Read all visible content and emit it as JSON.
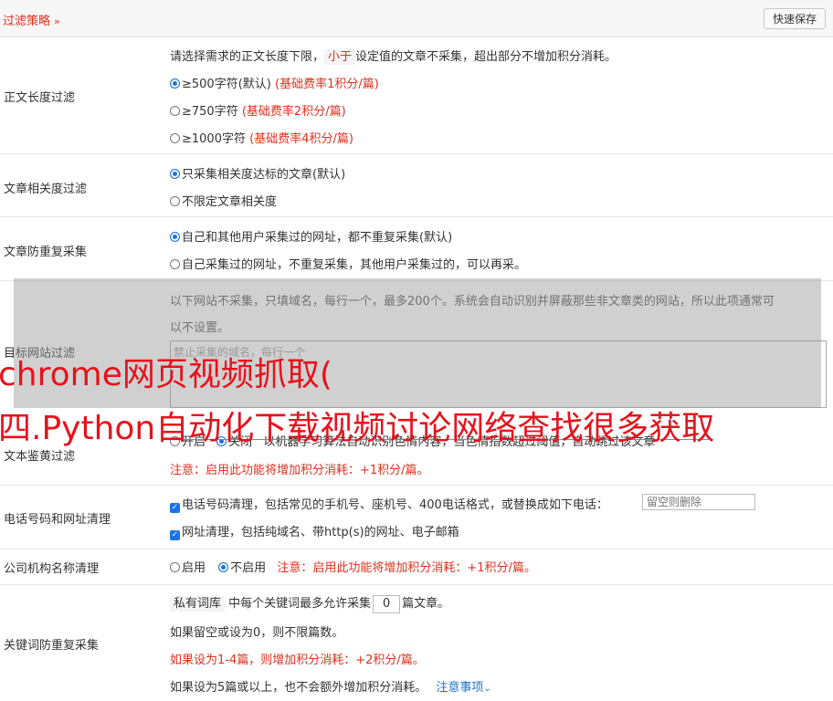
{
  "header": {
    "title": "过滤策略",
    "chevron": "»",
    "save_label": "快速保存"
  },
  "length_filter": {
    "label": "正文长度过滤",
    "desc_pre": "请选择需求的正文长度下限，",
    "desc_tag": "小于",
    "desc_post": "设定值的文章不采集，超出部分不增加积分消耗。",
    "options": [
      {
        "text": "≥500字符(默认)",
        "note": "(基础费率1积分/篇)",
        "checked": true
      },
      {
        "text": "≥750字符",
        "note": "(基础费率2积分/篇)",
        "checked": false
      },
      {
        "text": "≥1000字符",
        "note": "(基础费率4积分/篇)",
        "checked": false
      }
    ]
  },
  "relevance_filter": {
    "label": "文章相关度过滤",
    "options": [
      {
        "text": "只采集相关度达标的文章(默认)",
        "checked": true
      },
      {
        "text": "不限定文章相关度",
        "checked": false
      }
    ]
  },
  "dup_filter": {
    "label": "文章防重复采集",
    "options": [
      {
        "text": "自己和其他用户采集过的网址，都不重复采集(默认)",
        "checked": true
      },
      {
        "text": "自己采集过的网址，不重复采集，其他用户采集过的，可以再采。",
        "checked": false
      }
    ]
  },
  "site_filter": {
    "label": "目标网站过滤",
    "desc_line1": "以下网站不采集，只填域名，每行一个，最多200个。系统会自动识别并屏蔽那些非文章类的网站，所以此项通常可",
    "desc_line2": "以不设置。",
    "placeholder": "禁止采集的域名，每行一个"
  },
  "porn_filter": {
    "label": "文本鉴黄过滤",
    "opt_on": "开启",
    "opt_off": "关闭",
    "desc": "以机器学习算法自动识别色情内容，当色情指数超过阈值，自动跳过该文章",
    "note": "注意：启用此功能将增加积分消耗：+1积分/篇。"
  },
  "phone_clean": {
    "label": "电话号码和网址清理",
    "opt1": "电话号码清理，包括常见的手机号、座机号、400电话格式，或替换成如下电话：",
    "opt1_placeholder": "留空则删除",
    "opt2": "网址清理，包括纯域名、带http(s)的网址、电子邮箱"
  },
  "org_clean": {
    "label": "公司机构名称清理",
    "opt_on": "启用",
    "opt_off": "不启用",
    "note": "注意：启用此功能将增加积分消耗：+1积分/篇。"
  },
  "keyword_dup": {
    "label": "关键词防重复采集",
    "tag": "私有词库",
    "line1_mid": "中每个关键词最多允许采集",
    "value": "0",
    "line1_post": "篇文章。",
    "line2": "如果留空或设为0，则不限篇数。",
    "line3": "如果设为1-4篇，则增加积分消耗：+2积分/篇。",
    "line4": "如果设为5篇或以上，也不会额外增加积分消耗。",
    "link": "注意事项",
    "link_icon": "chevron-down-icon"
  },
  "watermark": {
    "line1": "chrome网页视频抓取(",
    "line2": "四.Python自动化下载视频讨论网络查找很多获取"
  },
  "colors": {
    "accent_red": "#e0301e",
    "link_blue": "#1a73c8",
    "watermark_red": "#e8111b"
  }
}
